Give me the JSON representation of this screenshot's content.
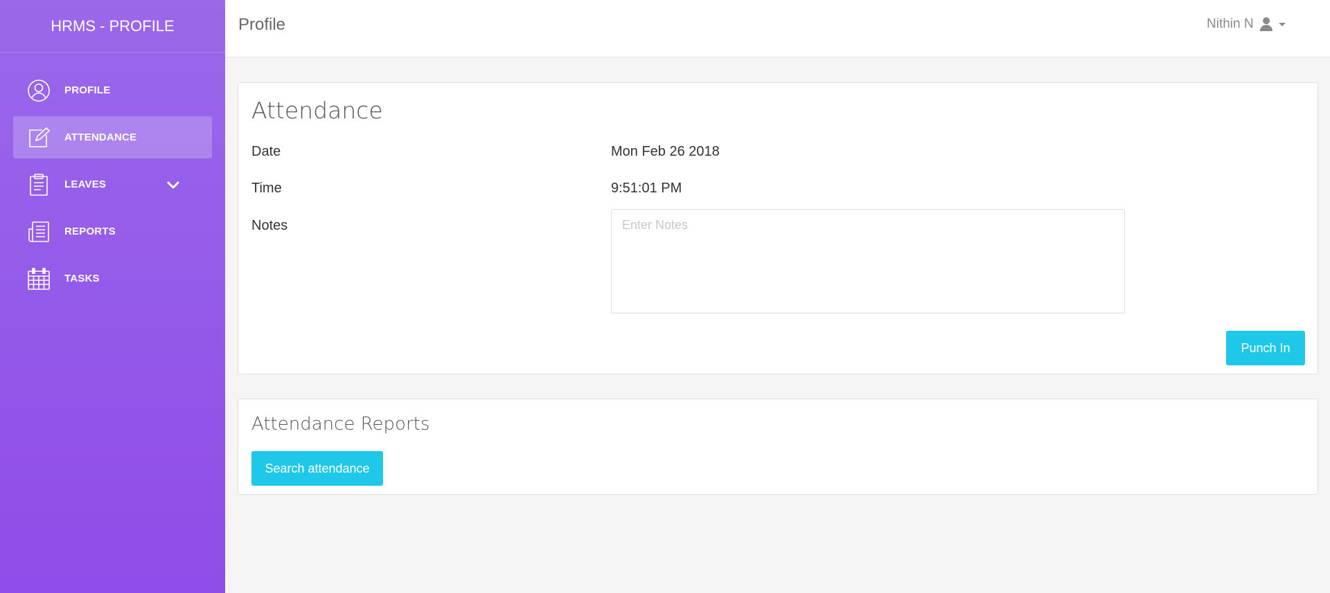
{
  "app": {
    "brand": "HRMS - PROFILE"
  },
  "header": {
    "title": "Profile",
    "user_name": "Nithin N",
    "user_icon": "user-icon"
  },
  "sidebar": {
    "items": [
      {
        "label": "PROFILE",
        "icon": "user-circle-icon",
        "active": false
      },
      {
        "label": "ATTENDANCE",
        "icon": "edit-icon",
        "active": true
      },
      {
        "label": "LEAVES",
        "icon": "clipboard-icon",
        "active": false,
        "expandable": true
      },
      {
        "label": "REPORTS",
        "icon": "newspaper-icon",
        "active": false
      },
      {
        "label": "TASKS",
        "icon": "calendar-icon",
        "active": false
      }
    ]
  },
  "attendance": {
    "title": "Attendance",
    "date_label": "Date",
    "date_value": "Mon Feb 26 2018",
    "time_label": "Time",
    "time_value": "9:51:01 PM",
    "notes_label": "Notes",
    "notes_value": "",
    "notes_placeholder": "Enter Notes",
    "punch_button": "Punch In"
  },
  "reports": {
    "title": "Attendance Reports",
    "search_button": "Search attendance"
  },
  "colors": {
    "sidebar_top": "#9a68ea",
    "sidebar_bottom": "#8f4ce8",
    "accent": "#1fc8e9"
  }
}
